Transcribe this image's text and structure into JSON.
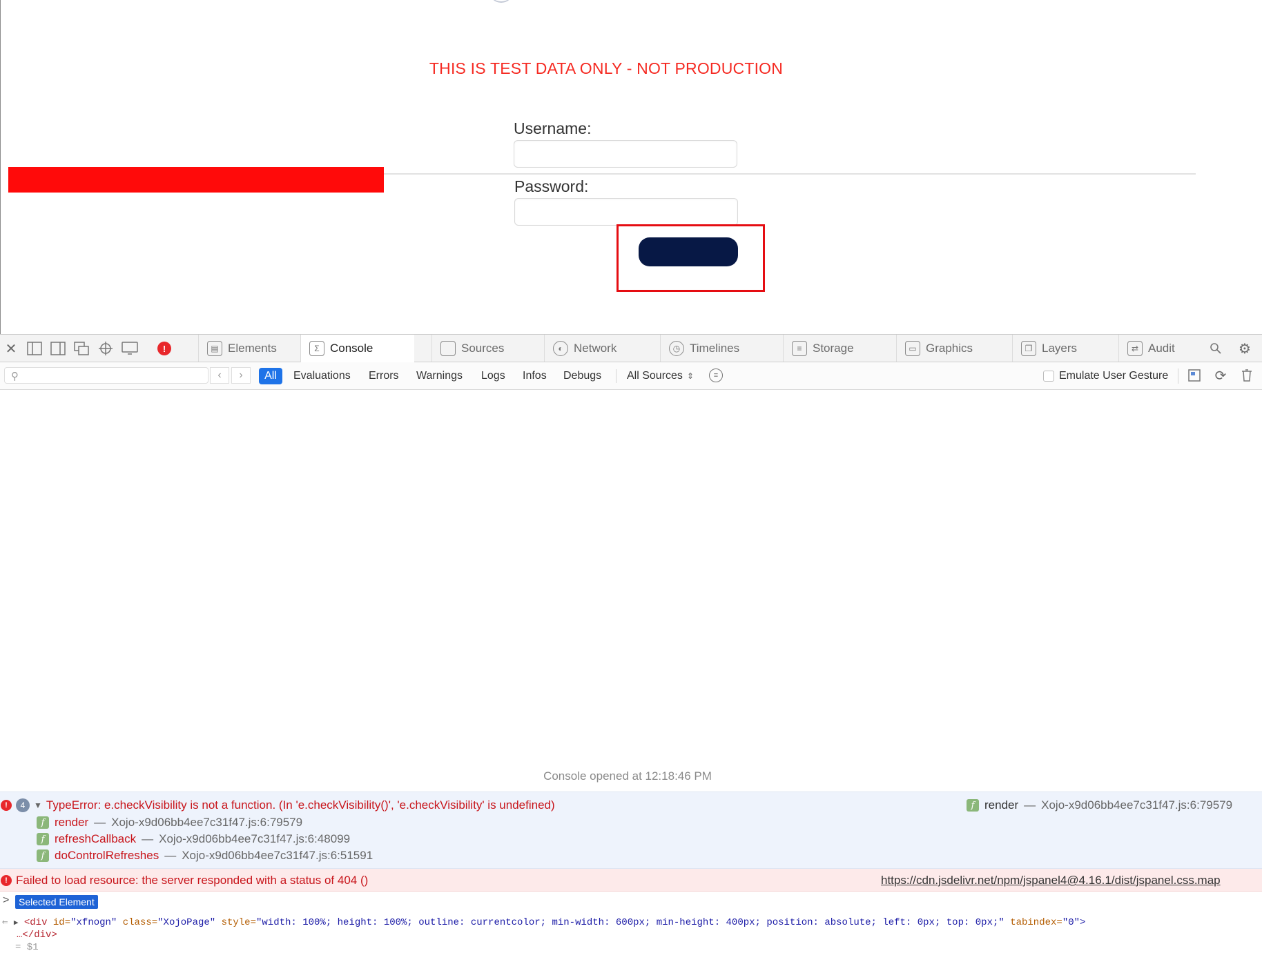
{
  "page": {
    "warning": "THIS IS TEST DATA ONLY - NOT PRODUCTION",
    "username_label": "Username:",
    "password_label": "Password:"
  },
  "devtools": {
    "tabs": [
      "Elements",
      "Console",
      "Sources",
      "Network",
      "Timelines",
      "Storage",
      "Graphics",
      "Layers",
      "Audit"
    ],
    "active_tab": "Console",
    "filters": {
      "levels": [
        "All",
        "Evaluations",
        "Errors",
        "Warnings",
        "Logs",
        "Infos",
        "Debugs"
      ],
      "active": "All",
      "sources": "All Sources",
      "emulate_label": "Emulate User Gesture"
    },
    "console": {
      "opened_text": "Console opened at 12:18:46 PM",
      "error_group": {
        "count": "4",
        "message": "TypeError: e.checkVisibility is not a function. (In 'e.checkVisibility()', 'e.checkVisibility' is undefined)",
        "right_name": "render",
        "right_loc": "Xojo-x9d06bb4ee7c31f47.js:6:79579",
        "frames": [
          {
            "name": "render",
            "loc": "Xojo-x9d06bb4ee7c31f47.js:6:79579"
          },
          {
            "name": "refreshCallback",
            "loc": "Xojo-x9d06bb4ee7c31f47.js:6:48099"
          },
          {
            "name": "doControlRefreshes",
            "loc": "Xojo-x9d06bb4ee7c31f47.js:6:51591"
          }
        ]
      },
      "error_404": {
        "message": "Failed to load resource: the server responded with a status of 404 ()",
        "url": "https://cdn.jsdelivr.net/npm/jspanel4@4.16.1/dist/jspanel.css.map"
      },
      "selected_label": "Selected Element",
      "element": {
        "tag_open": "<div",
        "attr_id_name": "id=",
        "attr_id_val": "\"xfnogn\"",
        "attr_class_name": "class=",
        "attr_class_val": "\"XojoPage\"",
        "attr_style_name": "style=",
        "attr_style_val": "\"width: 100%; height: 100%; outline: currentcolor; min-width: 600px; min-height: 400px; position: absolute; left: 0px; top: 0px;\"",
        "attr_tab_name": "tabindex=",
        "attr_tab_val": "\"0\">",
        "close": "…</div>",
        "result": "= $1"
      }
    }
  },
  "colors": {
    "warning": "#f52a22",
    "login_button": "#071845",
    "highlight": "#e50d12",
    "redaction": "#ff0a0a",
    "error_text": "#c8151b",
    "active_filter": "#1e73e8"
  }
}
